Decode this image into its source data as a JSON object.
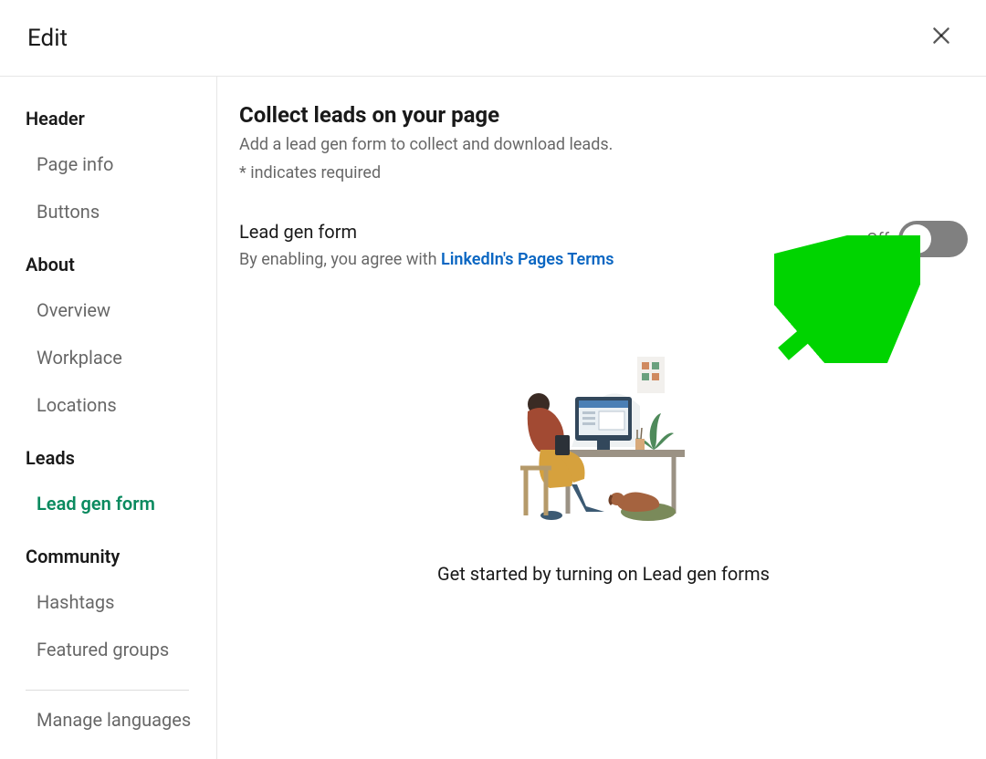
{
  "header": {
    "title": "Edit"
  },
  "sidebar": {
    "sections": [
      {
        "label": "Header",
        "items": [
          {
            "label": "Page info",
            "active": false
          },
          {
            "label": "Buttons",
            "active": false
          }
        ]
      },
      {
        "label": "About",
        "items": [
          {
            "label": "Overview",
            "active": false
          },
          {
            "label": "Workplace",
            "active": false
          },
          {
            "label": "Locations",
            "active": false
          }
        ]
      },
      {
        "label": "Leads",
        "items": [
          {
            "label": "Lead gen form",
            "active": true
          }
        ]
      },
      {
        "label": "Community",
        "items": [
          {
            "label": "Hashtags",
            "active": false
          },
          {
            "label": "Featured groups",
            "active": false
          }
        ]
      }
    ],
    "footer_item": "Manage languages"
  },
  "main": {
    "title": "Collect leads on your page",
    "subtitle": "Add a lead gen form to collect and download leads.",
    "required_note": "*  indicates required",
    "toggle": {
      "label": "Lead gen form",
      "desc_prefix": "By enabling, you agree with ",
      "desc_link": "LinkedIn's Pages Terms",
      "state_label": "Off"
    },
    "empty_caption": "Get started by turning on Lead gen forms"
  }
}
